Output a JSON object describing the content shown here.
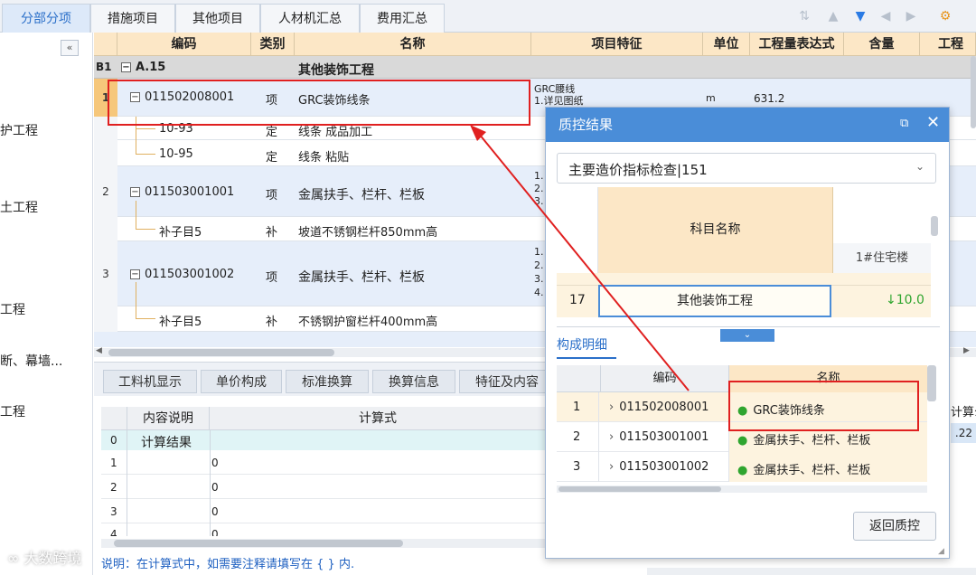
{
  "top_tabs": [
    "分部分项",
    "措施项目",
    "其他项目",
    "人材机汇总",
    "费用汇总"
  ],
  "left_nav": [
    "护工程",
    "土工程",
    "工程",
    "断、幕墙...",
    "工程"
  ],
  "grid": {
    "headers": [
      "编码",
      "类别",
      "名称",
      "项目特征",
      "单位",
      "工程量表达式",
      "含量",
      "工程"
    ],
    "section": {
      "index": "B1",
      "code": "A.15",
      "name": "其他装饰工程"
    },
    "rows": [
      {
        "num": "1",
        "code": "011502008001",
        "type": "项",
        "name": "GRC装饰线条",
        "feature": "GRC腰线\n1.详见图纸",
        "unit": "m",
        "expr": "631.2"
      },
      {
        "num": "",
        "code": "10-93",
        "type": "定",
        "name": "线条 成品加工",
        "feature": "",
        "unit": "",
        "expr": ""
      },
      {
        "num": "",
        "code": "10-95",
        "type": "定",
        "name": "线条 粘贴",
        "feature": "",
        "unit": "",
        "expr": ""
      },
      {
        "num": "2",
        "code": "011503001001",
        "type": "项",
        "name": "金属扶手、栏杆、栏板",
        "feature": "1.\n2.\n3.",
        "unit": "",
        "expr": ""
      },
      {
        "num": "",
        "code": "补子目5",
        "type": "补",
        "name": "坡道不锈钢栏杆850mm高",
        "feature": "",
        "unit": "",
        "expr": ""
      },
      {
        "num": "3",
        "code": "011503001002",
        "type": "项",
        "name": "金属扶手、栏杆、栏板",
        "feature": "1.\n2.\n3.\n4.",
        "unit": "",
        "expr": ""
      },
      {
        "num": "",
        "code": "补子目5",
        "type": "补",
        "name": "不锈钢护窗栏杆400mm高",
        "feature": "",
        "unit": "",
        "expr": ""
      }
    ]
  },
  "bottom_tabs": [
    "工料机显示",
    "单价构成",
    "标准换算",
    "换算信息",
    "特征及内容"
  ],
  "calc": {
    "headers": [
      "内容说明",
      "计算式"
    ],
    "rows": [
      {
        "num": "0",
        "desc": "计算结果",
        "expr": ""
      },
      {
        "num": "1",
        "desc": "",
        "expr": "0"
      },
      {
        "num": "2",
        "desc": "",
        "expr": "0"
      },
      {
        "num": "3",
        "desc": "",
        "expr": "0"
      },
      {
        "num": "4",
        "desc": "",
        "expr": "0"
      }
    ],
    "right_header": "计算么",
    "right_value": ".22"
  },
  "status_text": "说明：在计算式中，如需要注释请填写在 { } 内.",
  "watermark": "大数跨境",
  "dialog": {
    "title": "质控结果",
    "dropdown": "主要造价指标检查|151",
    "top_grid": {
      "header": "科目名称",
      "sub_header": "1#住宅楼",
      "row": {
        "num": "17",
        "name": "其他装饰工程",
        "value": "↓10.0"
      }
    },
    "section_label": "构成明细",
    "detail_headers": [
      "编码",
      "名称"
    ],
    "detail_rows": [
      {
        "num": "1",
        "code": "011502008001",
        "name": "GRC装饰线条"
      },
      {
        "num": "2",
        "code": "011503001001",
        "name": "金属扶手、栏杆、栏板"
      },
      {
        "num": "3",
        "code": "011503001002",
        "name": "金属扶手、栏杆、栏板"
      }
    ],
    "return_button": "返回质控"
  },
  "colors": {
    "accent": "#4a8dd8",
    "header_bg": "#fce7c6",
    "annotation": "#e02020",
    "success": "#2fa52f"
  }
}
